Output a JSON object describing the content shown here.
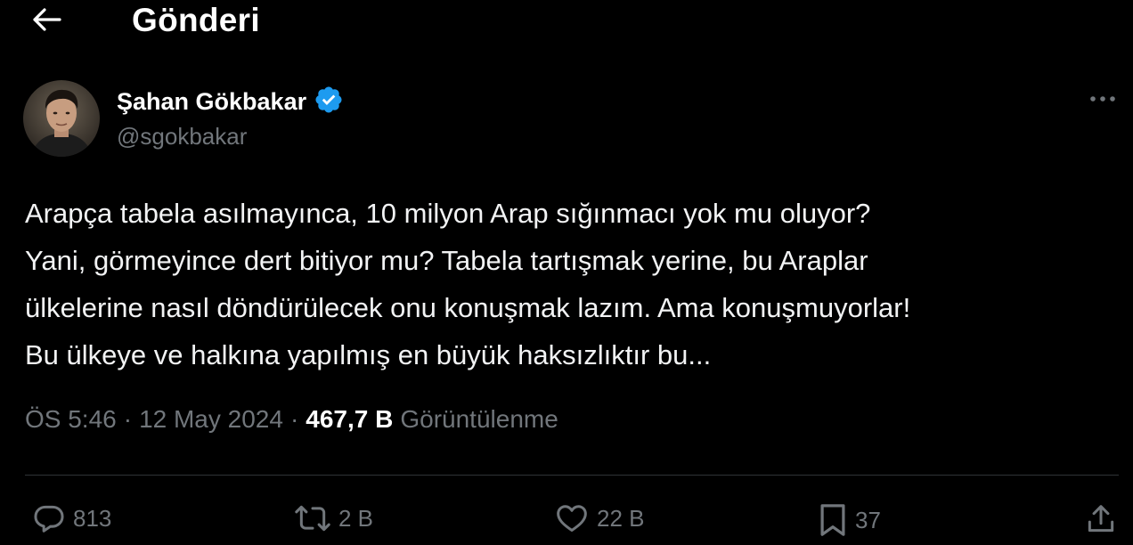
{
  "header": {
    "title": "Gönderi",
    "back_icon": "arrow-left-icon"
  },
  "author": {
    "name": "Şahan Gökbakar",
    "handle": "@sgokbakar",
    "verified_icon": "verified-badge-icon",
    "verified_color": "#1d9bf0"
  },
  "tweet": {
    "text": "Arapça tabela asılmayınca, 10 milyon Arap sığınmacı yok mu oluyor?\nYani, görmeyince dert bitiyor mu? Tabela tartışmak yerine, bu Araplar\nülkelerine nasıl döndürülecek onu konuşmak lazım. Ama konuşmuyorlar!\nBu ülkeye ve halkına yapılmış en büyük haksızlıktır bu..."
  },
  "meta": {
    "time": "ÖS 5:46",
    "separator": "·",
    "date": "12 May 2024",
    "views_count": "467,7 B",
    "views_label": "Görüntülenme"
  },
  "actions": {
    "replies": "813",
    "retweets": "2 B",
    "likes": "22 B",
    "bookmarks": "37"
  },
  "colors": {
    "background": "#000000",
    "text": "#e7e9ea",
    "secondary": "#71767b",
    "accent": "#1d9bf0"
  }
}
